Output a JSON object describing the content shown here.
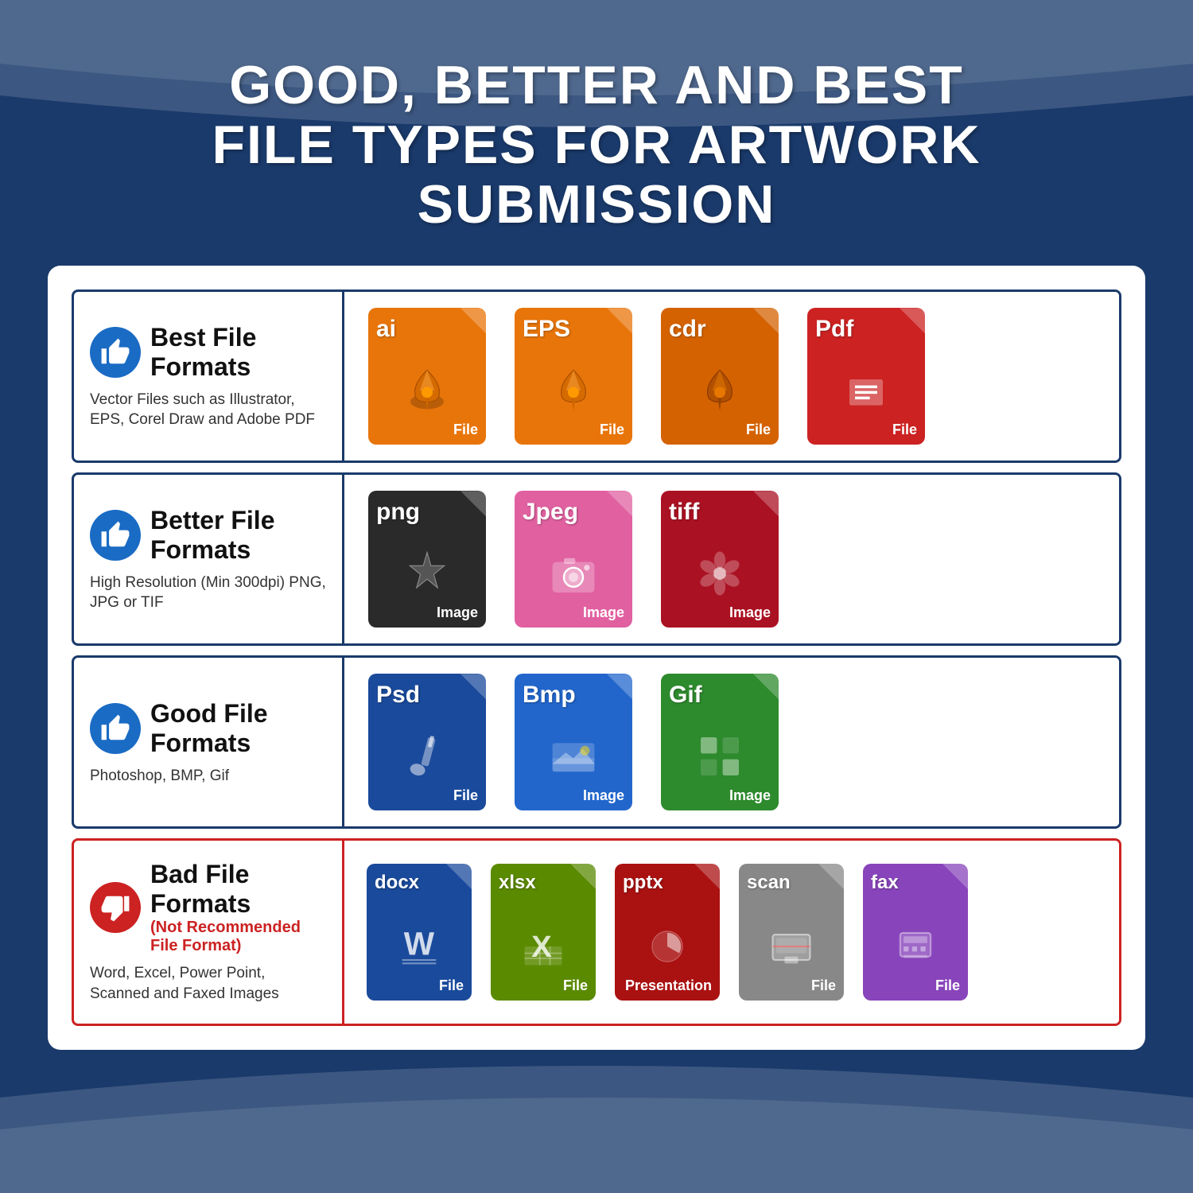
{
  "page": {
    "background_color": "#1a3a6b",
    "title_line1": "GOOD, BETTER AND BEST",
    "title_line2": "FILE TYPES FOR ARTWORK SUBMISSION"
  },
  "rows": [
    {
      "id": "best",
      "thumb": "up",
      "category": "Best File Formats",
      "subtitle": null,
      "description": "Vector Files such as Illustrator, EPS, Corel Draw and Adobe PDF",
      "border_color": "#1a3a6b",
      "files": [
        {
          "ext": "ai",
          "label": "File",
          "color": "orange",
          "icon": "pen"
        },
        {
          "ext": "EPS",
          "label": "File",
          "color": "orange",
          "icon": "pen"
        },
        {
          "ext": "cdr",
          "label": "File",
          "color": "dark-orange",
          "icon": "pen"
        },
        {
          "ext": "Pdf",
          "label": "File",
          "color": "red",
          "icon": "doc"
        }
      ]
    },
    {
      "id": "better",
      "thumb": "up",
      "category": "Better File Formats",
      "subtitle": null,
      "description": "High Resolution (Min 300dpi) PNG, JPG or TIF",
      "border_color": "#1a3a6b",
      "files": [
        {
          "ext": "png",
          "label": "Image",
          "color": "black",
          "icon": "star"
        },
        {
          "ext": "Jpeg",
          "label": "Image",
          "color": "pink",
          "icon": "camera"
        },
        {
          "ext": "tiff",
          "label": "Image",
          "color": "crimson",
          "icon": "flower"
        }
      ]
    },
    {
      "id": "good",
      "thumb": "up",
      "category": "Good File Formats",
      "subtitle": null,
      "description": "Photoshop, BMP, Gif",
      "border_color": "#1a3a6b",
      "files": [
        {
          "ext": "Psd",
          "label": "File",
          "color": "navy",
          "icon": "brush"
        },
        {
          "ext": "Bmp",
          "label": "Image",
          "color": "blue",
          "icon": "landscape"
        },
        {
          "ext": "Gif",
          "label": "Image",
          "color": "green",
          "icon": "grid"
        }
      ]
    },
    {
      "id": "bad",
      "thumb": "down",
      "category": "Bad File Formats",
      "subtitle": "(Not Recommended File Format)",
      "description": "Word, Excel, Power Point, Scanned and Faxed Images",
      "border_color": "#cc2222",
      "files": [
        {
          "ext": "docx",
          "label": "File",
          "color": "navy",
          "icon": "word"
        },
        {
          "ext": "xlsx",
          "label": "File",
          "color": "olive",
          "icon": "excel"
        },
        {
          "ext": "pptx",
          "label": "Presentation",
          "color": "dark-red",
          "icon": "ppt"
        },
        {
          "ext": "scan",
          "label": "File",
          "color": "gray",
          "icon": "scan"
        },
        {
          "ext": "fax",
          "label": "File",
          "color": "purple",
          "icon": "fax"
        }
      ]
    }
  ],
  "thumb_labels": {
    "up": "thumbs up",
    "down": "thumbs down"
  }
}
